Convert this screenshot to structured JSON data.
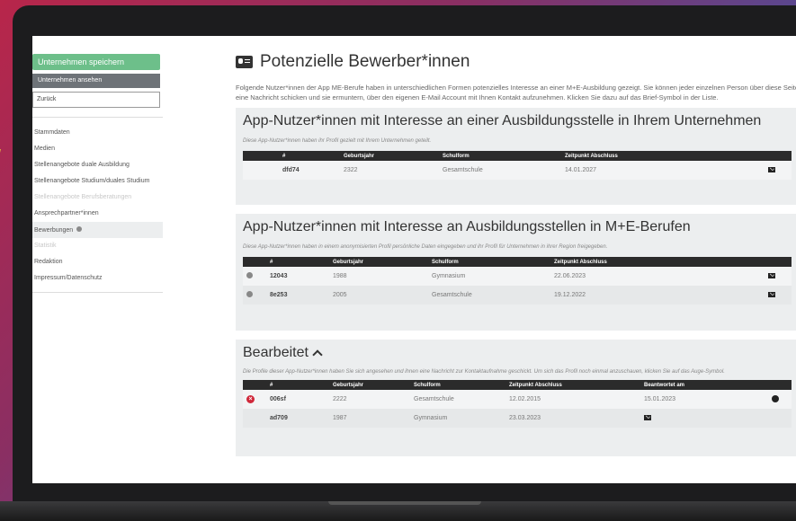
{
  "sidebar": {
    "save_button": "Unternehmen speichern",
    "view_button": "Unternehmen ansehen",
    "back_value": "Zurück",
    "nav": [
      "Stammdaten",
      "Medien",
      "Stellenangebote duale Ausbildung",
      "Stellenangebote Studium/duales Studium",
      "Stellenangebote Berufsberatungen",
      "Ansprechpartner*innen",
      "Bewerbungen",
      "Statistik",
      "Redaktion",
      "Impressum/Datenschutz"
    ]
  },
  "main": {
    "title": "Potenzielle Bewerber*innen",
    "intro": "Folgende Nutzer*innen der App ME-Berufe haben in unterschiedlichen Formen potenzielles Interesse an einer M+E-Ausbildung gezeigt. Sie können jeder einzelnen Person über diese Seite eine Nachricht schicken und sie ermuntern, über den eigenen E-Mail Account mit Ihnen Kontakt aufzunehmen. Klicken Sie dazu auf das Brief-Symbol in der Liste."
  },
  "section1": {
    "title": "App-Nutzer*innen mit Interesse an einer Ausbildungsstelle in Ihrem Unternehmen",
    "desc": "Diese App-Nutzer*innen haben ihr Profil gezielt mit Ihrem Unternehmen geteilt.",
    "headers": [
      "#",
      "Geburtsjahr",
      "Schulform",
      "Zeitpunkt Abschluss"
    ],
    "rows": [
      {
        "nick": "dfd74",
        "year": "2322",
        "school": "Gesamtschule",
        "date": "14.01.2027"
      }
    ]
  },
  "section2": {
    "title": "App-Nutzer*innen mit Interesse an Ausbildungsstellen in M+E-Berufen",
    "desc": "Diese App-Nutzer*innen haben in einem anonymisierten Profil persönliche Daten eingegeben und ihr Profil für Unternehmen in ihrer Region freigegeben.",
    "headers": [
      "#",
      "Geburtsjahr",
      "Schulform",
      "Zeitpunkt Abschluss"
    ],
    "rows": [
      {
        "nick": "12043",
        "year": "1988",
        "school": "Gymnasium",
        "date": "22.06.2023"
      },
      {
        "nick": "8e253",
        "year": "2005",
        "school": "Gesamtschule",
        "date": "19.12.2022"
      }
    ]
  },
  "section3": {
    "title": "Bearbeitet",
    "desc": "Die Profile dieser App-Nutzer*innen haben Sie sich angesehen und ihnen eine Nachricht zur Kontaktaufnahme geschickt. Um sich das Profil noch einmal anzuschauen, klicken Sie auf das Auge-Symbol.",
    "headers": [
      "#",
      "Geburtsjahr",
      "Schulform",
      "Zeitpunkt Abschluss",
      "Beantwortet am"
    ],
    "rows": [
      {
        "nick": "006sf",
        "year": "2222",
        "school": "Gesamtschule",
        "date": "12.02.2015",
        "answered": "15.01.2023"
      },
      {
        "nick": "ad709",
        "year": "1987",
        "school": "Gymnasium",
        "date": "23.03.2023",
        "answered": ""
      }
    ]
  },
  "colors": {
    "green": "#6dbf8a",
    "gray_button": "#6e7378",
    "header": "#2b2b2b",
    "red": "#d0283a"
  }
}
